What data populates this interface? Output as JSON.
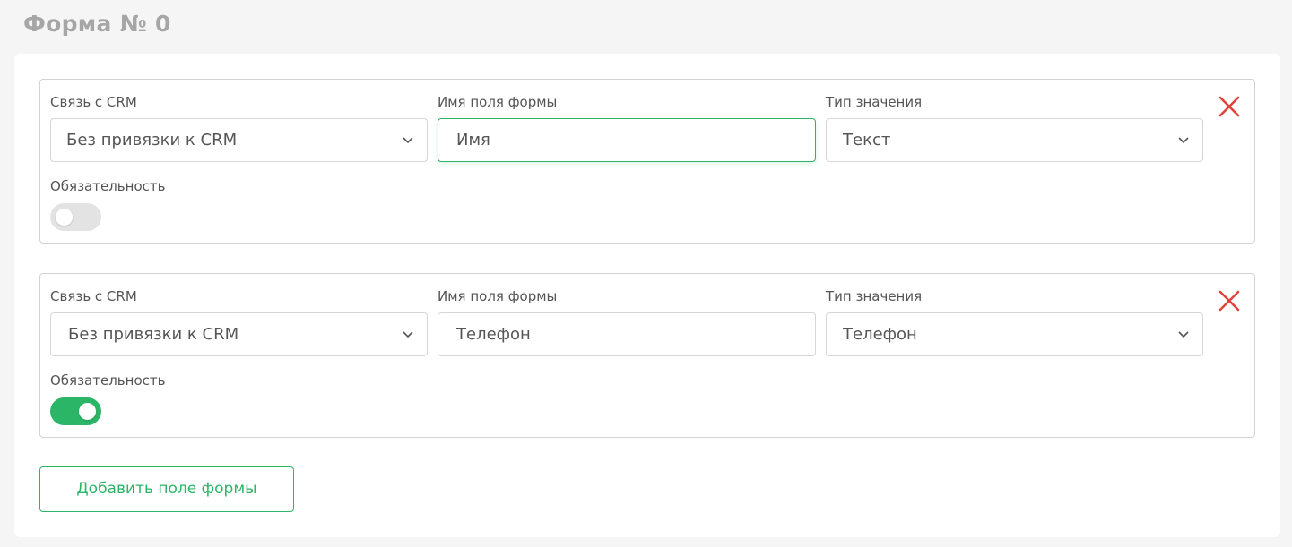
{
  "form": {
    "title": "Форма № 0",
    "add_button_label": "Добавить поле формы"
  },
  "fields": [
    {
      "crm_label": "Связь с CRM",
      "crm_value": "Без привязки к CRM",
      "name_label": "Имя поля формы",
      "name_value": "Имя",
      "type_label": "Тип значения",
      "type_value": "Текст",
      "required_label": "Обязательность",
      "required": false,
      "name_focused": true
    },
    {
      "crm_label": "Связь с CRM",
      "crm_value": "Без привязки к CRM",
      "name_label": "Имя поля формы",
      "name_value": "Телефон",
      "type_label": "Тип значения",
      "type_value": "Телефон",
      "required_label": "Обязательность",
      "required": true,
      "name_focused": false
    }
  ],
  "icons": {
    "delete": "close-icon",
    "dropdown": "chevron-down-icon"
  },
  "colors": {
    "accent": "#2bb567",
    "delete": "#e0453c",
    "title": "#a6a6a6",
    "toggle_off": "#e3e3e3"
  }
}
